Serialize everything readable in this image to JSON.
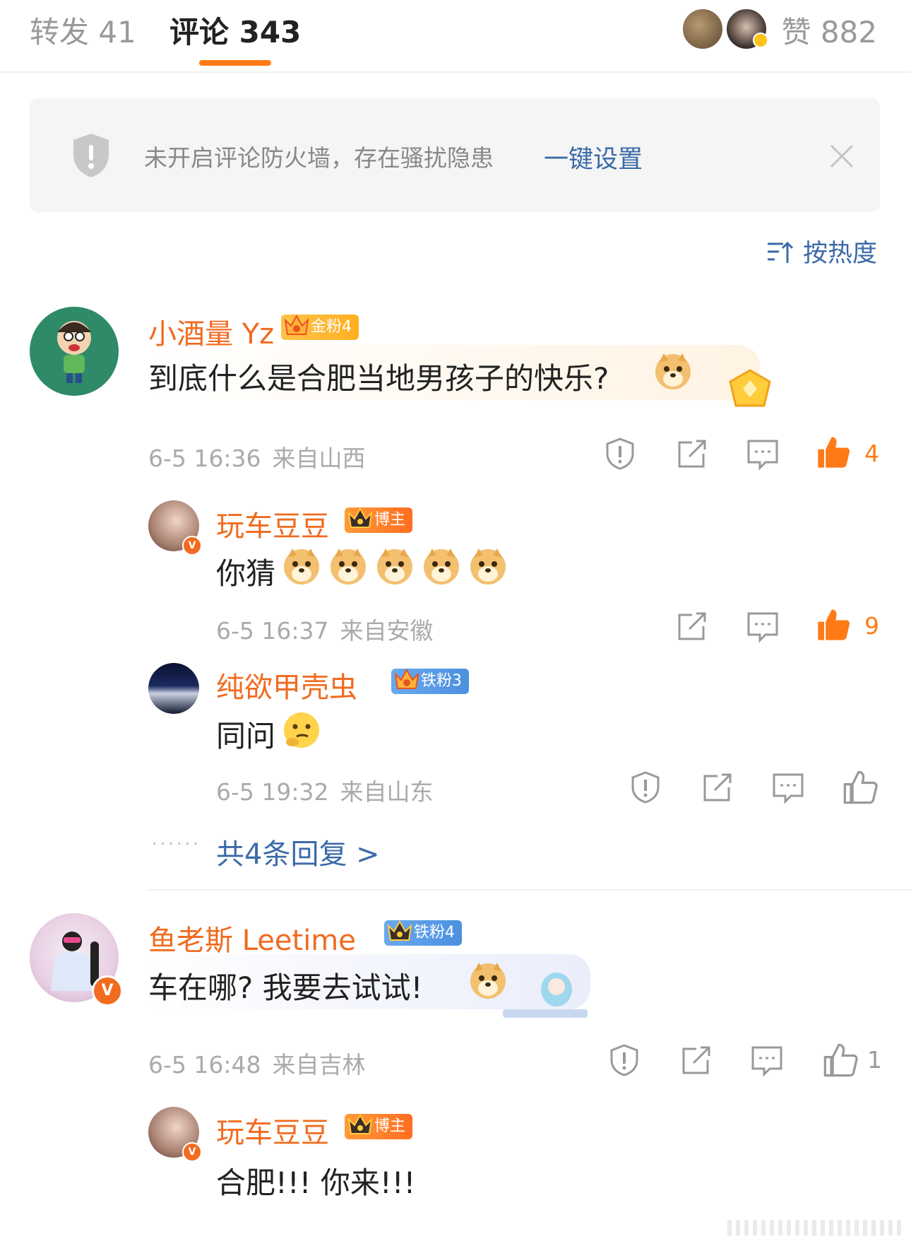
{
  "header": {
    "tab_repost": "转发 41",
    "tab_comments": "评论 343",
    "likes": "赞 882"
  },
  "banner": {
    "text": "未开启评论防火墙，存在骚扰隐患",
    "link": "一键设置"
  },
  "sort": {
    "label": "按热度"
  },
  "comments": [
    {
      "user": "小酒量 Yz",
      "badge": "金粉4",
      "text": "到底什么是合肥当地男孩子的快乐?",
      "time": "6-5 16:36",
      "location": "来自山西",
      "likes": "4"
    },
    {
      "user": "玩车豆豆",
      "badge": "博主",
      "text": "你猜",
      "time": "6-5 16:37",
      "location": "来自安徽",
      "likes": "9"
    },
    {
      "user": "纯欲甲壳虫",
      "badge": "铁粉3",
      "text": "同问",
      "time": "6-5 19:32",
      "location": "来自山东",
      "likes": ""
    },
    {
      "user": "鱼老斯 Leetime",
      "badge": "铁粉4",
      "text": "车在哪? 我要去试试!",
      "time": "6-5 16:48",
      "location": "来自吉林",
      "likes": "1"
    },
    {
      "user": "玩车豆豆",
      "badge": "博主",
      "text": "合肥!!! 你来!!!"
    }
  ],
  "more_replies": "共4条回复 >",
  "colors": {
    "accent": "#ff7a16",
    "username": "#f06b1f",
    "link": "#3b6aa8"
  },
  "icons": [
    "shield-icon",
    "close-icon",
    "sort-icon",
    "report-icon",
    "share-icon",
    "comment-icon",
    "thumbs-up-icon",
    "doge-emoji-icon",
    "thinking-emoji-icon",
    "verified-icon",
    "crown-icon"
  ]
}
